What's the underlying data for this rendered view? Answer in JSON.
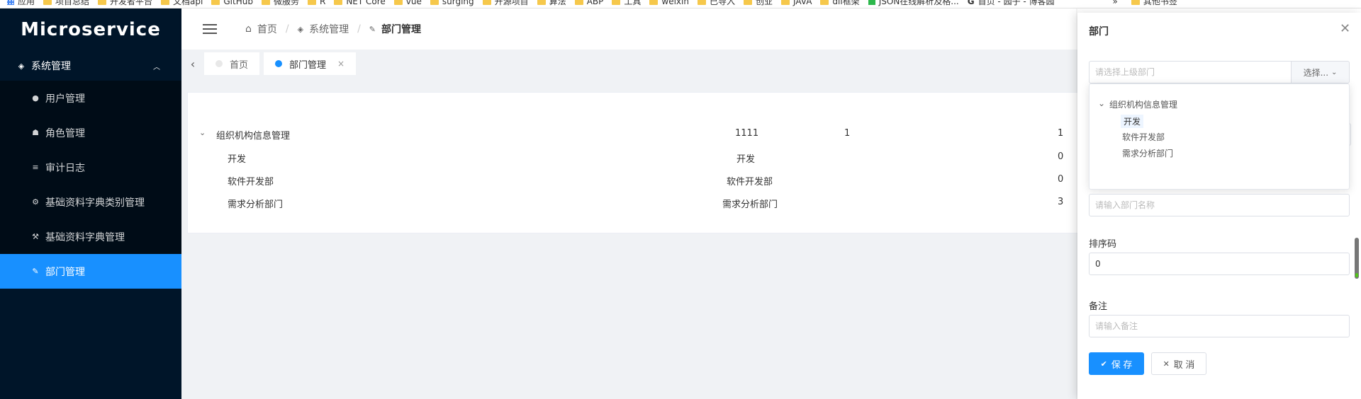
{
  "bookmarks": [
    "应用",
    "项目总结",
    "开发者平台",
    "文档api",
    "GitHub",
    "微服务",
    "R",
    "NET Core",
    "vue",
    "surging",
    "开源项目",
    "算法",
    "ABP",
    "工具",
    "weixin",
    "已导入",
    "创业",
    "JAVA",
    "dll框架",
    "JSON在线解析及格...",
    "首页 - 园子 - 博客园",
    "其他书签"
  ],
  "sidebar": {
    "logo": "Microservice",
    "group": {
      "label": "系统管理",
      "icon": "layers-icon"
    },
    "items": [
      {
        "label": "用户管理",
        "icon": "user-icon"
      },
      {
        "label": "角色管理",
        "icon": "team-icon"
      },
      {
        "label": "审计日志",
        "icon": "list-icon"
      },
      {
        "label": "基础资料字典类别管理",
        "icon": "gear-icon"
      },
      {
        "label": "基础资料字典管理",
        "icon": "hammer-icon"
      },
      {
        "label": "部门管理",
        "icon": "wrench-icon",
        "active": true
      }
    ]
  },
  "breadcrumb": {
    "home": "首页",
    "system": "系统管理",
    "current": "部门管理"
  },
  "tabs": [
    {
      "label": "首页"
    },
    {
      "label": "部门管理",
      "active": true
    }
  ],
  "tree": [
    {
      "name": "组织机构信息管理",
      "code": "1111",
      "sort": "1",
      "count": "1"
    },
    {
      "name": "开发",
      "code": "开发",
      "sort": "",
      "count": "0"
    },
    {
      "name": "软件开发部",
      "code": "软件开发部",
      "sort": "",
      "count": "0"
    },
    {
      "name": "需求分析部门",
      "code": "需求分析部门",
      "sort": "",
      "count": "3"
    }
  ],
  "drawer": {
    "title": "部门",
    "parent_placeholder": "请选择上级部门",
    "select_button": "选择...",
    "dropdown": {
      "root": "组织机构信息管理",
      "children": [
        "开发",
        "软件开发部",
        "需求分析部门"
      ]
    },
    "name_placeholder": "请输入部门名称",
    "sort_label": "排序码",
    "sort_value": "0",
    "remark_label": "备注",
    "remark_placeholder": "请输入备注",
    "save_label": "保 存",
    "cancel_label": "取 消"
  }
}
